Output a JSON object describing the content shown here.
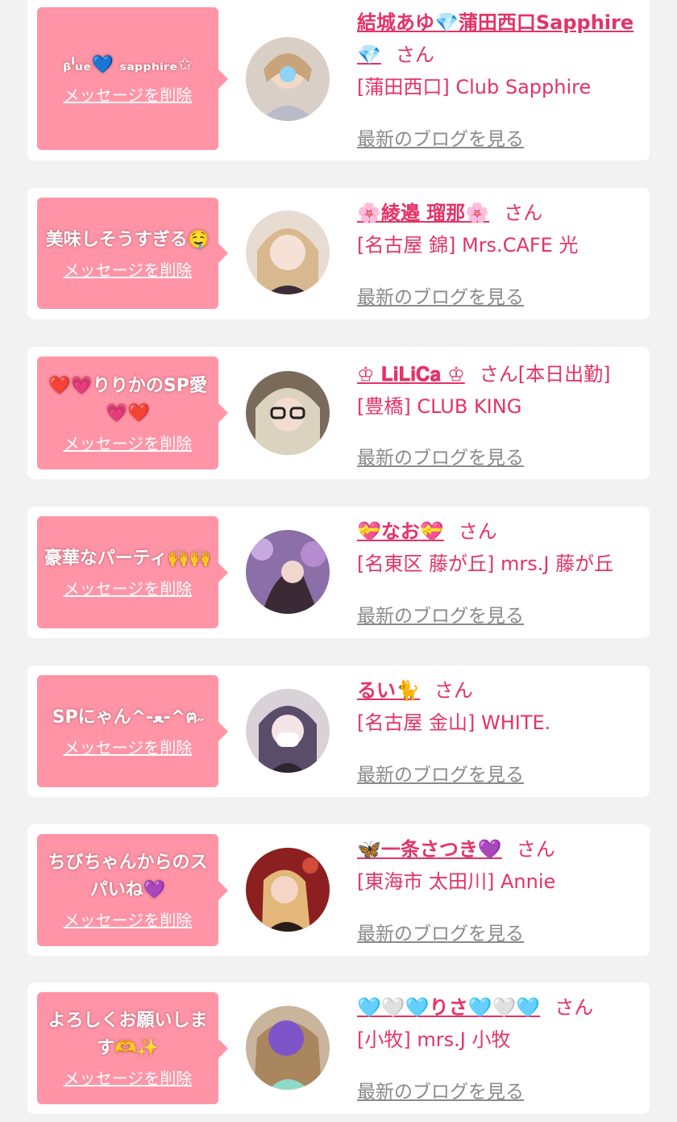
{
  "labels": {
    "delete_message": "メッセージを削除",
    "latest_blog": "最新のブログを見る"
  },
  "colors": {
    "page_background": "#f2f2f2",
    "bubble_pink": "#ff94a6",
    "name_pink": "#e53266",
    "link_gray": "#8a8a8a"
  },
  "items": [
    {
      "message": "ᵦˡᵤₑ💙 ₛₐₚₚₕᵢᵣₑ✩",
      "name": "結城あゆ💎蒲田西口Sapphire💎",
      "honorific": "さん",
      "status": "",
      "shop": "[蒲田西口] Club Sapphire"
    },
    {
      "message": "美味しそうすぎる🤤",
      "name": "🌸綾邉 瑠那🌸",
      "honorific": "さん",
      "status": "",
      "shop": "[名古屋 錦] Mrs.CAFE 光"
    },
    {
      "message": "❤️💗りりかのSP愛💗❤️",
      "name": "♔ 𝐋𝐢𝐋𝐢𝐂𝐚 ♔",
      "honorific": "さん",
      "status": "[本日出勤]",
      "shop": "[豊橋] CLUB KING"
    },
    {
      "message": "豪華なパーティ🙌🙌",
      "name": "💝なお💝",
      "honorific": "さん",
      "status": "",
      "shop": "[名東区 藤が丘] mrs.J 藤が丘"
    },
    {
      "message": "SPにゃん^-ﻌ-^ฅ˶",
      "name": "るい🐈",
      "honorific": "さん",
      "status": "",
      "shop": "[名古屋 金山] WHITE."
    },
    {
      "message": "ちびちゃんからのスパいね💜",
      "name": "🦋一条さつき💜",
      "honorific": "さん",
      "status": "",
      "shop": "[東海市 太田川] Annie"
    },
    {
      "message": "よろしくお願いします🫶✨",
      "name": "🩵🤍🩵りさ🩵🤍🩵",
      "honorific": "さん",
      "status": "",
      "shop": "[小牧] mrs.J 小牧"
    }
  ]
}
